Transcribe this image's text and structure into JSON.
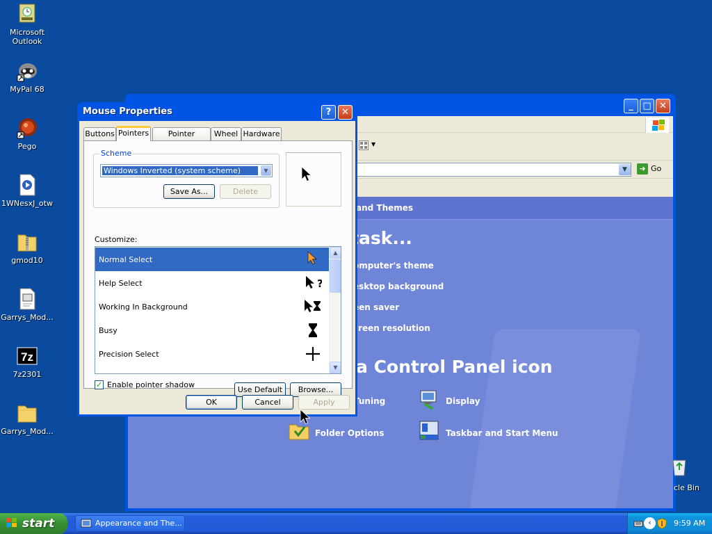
{
  "desktop": {
    "icons": [
      {
        "label": "Microsoft Outlook",
        "icon": "outlook-icon"
      },
      {
        "label": "MyPal 68",
        "icon": "mypal-icon"
      },
      {
        "label": "Pego",
        "icon": "pego-icon"
      },
      {
        "label": "1WNesxJ_otw",
        "icon": "media-file-icon"
      },
      {
        "label": "gmod10",
        "icon": "zip-folder-icon"
      },
      {
        "label": "Garrys_Mod...",
        "icon": "document-icon"
      },
      {
        "label": "7z2301",
        "icon": "7zip-icon"
      },
      {
        "label": "Garrys_Mod...",
        "icon": "folder-icon"
      }
    ],
    "recycle_bin_label": "cle Bin"
  },
  "control_panel": {
    "address_go": "Go",
    "header_fragment": "and Themes",
    "task_heading_fragment": "task...",
    "tasks": [
      "omputer's theme",
      "esktop background",
      "een saver",
      "creen resolution"
    ],
    "icon_heading_fragment": "a Control Panel icon",
    "icons": [
      {
        "label": "Tuning",
        "icon": "tuning-icon"
      },
      {
        "label": "Display",
        "icon": "display-icon"
      },
      {
        "label": "Folder Options",
        "icon": "folder-options-icon"
      },
      {
        "label": "Taskbar and Start Menu",
        "icon": "taskbar-icon"
      }
    ]
  },
  "dialog": {
    "title": "Mouse Properties",
    "help_glyph": "?",
    "close_glyph": "✕",
    "tabs": [
      "Buttons",
      "Pointers",
      "Pointer Options",
      "Wheel",
      "Hardware"
    ],
    "active_tab": "Pointers",
    "scheme": {
      "group_label": "Scheme",
      "selected": "Windows Inverted (system scheme)",
      "save_as": "Save As...",
      "delete": "Delete"
    },
    "customize_label": "Customize:",
    "cursors": [
      {
        "name": "Normal Select",
        "icon": "arrow-cursor-icon"
      },
      {
        "name": "Help Select",
        "icon": "help-cursor-icon"
      },
      {
        "name": "Working In Background",
        "icon": "working-cursor-icon"
      },
      {
        "name": "Busy",
        "icon": "hourglass-icon"
      },
      {
        "name": "Precision Select",
        "icon": "crosshair-icon"
      }
    ],
    "selected_cursor": "Normal Select",
    "shadow_checkbox": {
      "label": "Enable pointer shadow",
      "checked": true
    },
    "use_default": "Use Default",
    "browse": "Browse...",
    "ok": "OK",
    "cancel": "Cancel",
    "apply": "Apply"
  },
  "taskbar": {
    "start_label": "start",
    "task_item": "Appearance and The...",
    "clock": "9:59 AM"
  },
  "colors": {
    "desktop": "#0a4ba0",
    "xp_blue": "#0054e3",
    "selection": "#316ac5",
    "dialog_face": "#ece9d8",
    "start_green": "#378f35"
  }
}
